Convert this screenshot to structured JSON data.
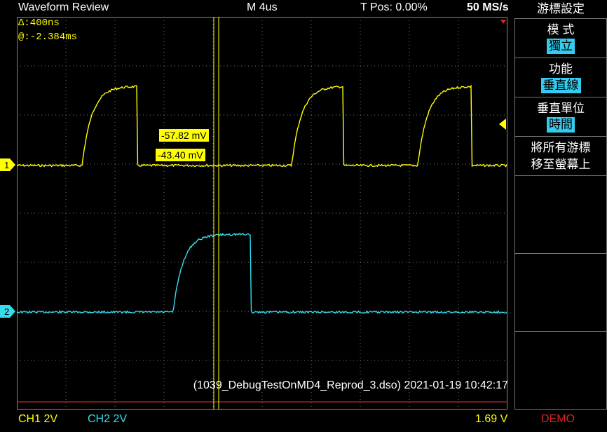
{
  "header": {
    "title": "Waveform Review",
    "timebase": "M 4us",
    "trigger_pos": "T Pos: 0.00%",
    "sample_rate": "50 MS/s"
  },
  "cursor_readout": {
    "delta": "Δ:400ns",
    "at": "@:-2.384ms"
  },
  "cursor_values": {
    "ch1_cursor_a": "-57.82 mV",
    "ch1_cursor_b": "-43.40 mV"
  },
  "channel_markers": {
    "ch1": "1",
    "ch2": "2"
  },
  "file_info": "(1039_DebugTestOnMD4_Reprod_3.dso) 2021-01-19 10:42:17",
  "status_bar": {
    "ch1": "CH1  2V",
    "ch2": "CH2  2V",
    "trigger_level": "1.69 V",
    "mode": "DEMO"
  },
  "menu": {
    "title": "游標設定",
    "items": [
      {
        "label": "模 式",
        "value": "獨立"
      },
      {
        "label": "功能",
        "value": "垂直線"
      },
      {
        "label": "垂直單位",
        "value": "時間"
      },
      {
        "label": "將所有游標",
        "label2": "移至螢幕上",
        "value": ""
      }
    ]
  },
  "colors": {
    "ch1": "#ffff00",
    "ch2": "#33ddee",
    "grid": "#666666",
    "trigger_line": "#cc2222",
    "demo": "#dd2222"
  },
  "icons": {
    "trigger_level": "trigger-level-icon",
    "trigger_position": "trigger-position-icon"
  }
}
